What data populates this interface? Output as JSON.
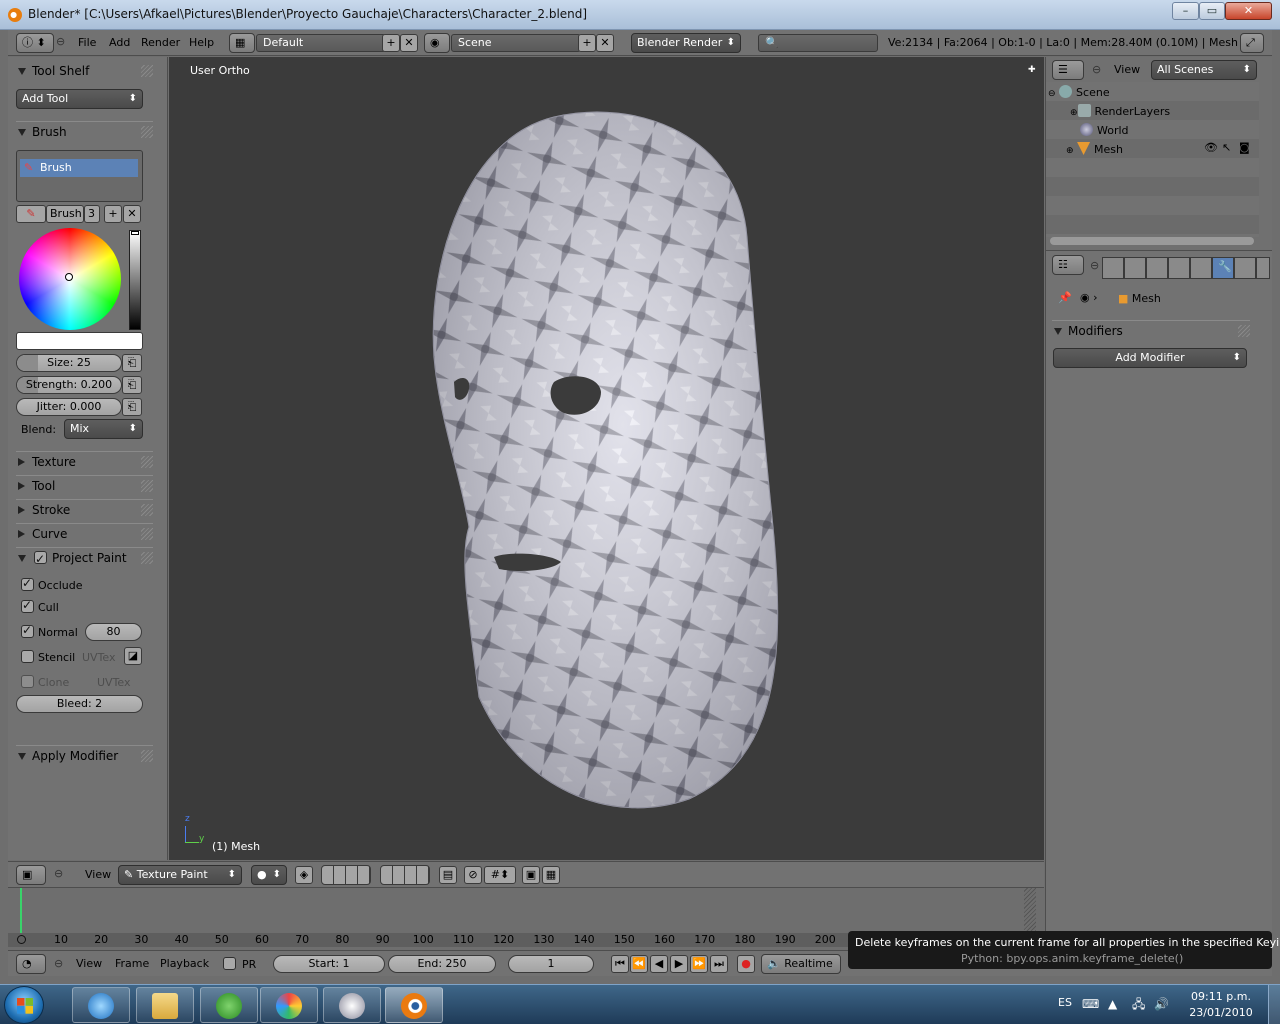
{
  "window": {
    "title": "Blender* [C:\\Users\\Afkael\\Pictures\\Blender\\Proyecto Gauchaje\\Characters\\Character_2.blend]",
    "minimize": "–",
    "maximize": "▭",
    "close": "✕"
  },
  "topheader": {
    "menus": [
      "File",
      "Add",
      "Render",
      "Help"
    ],
    "layout": "Default",
    "scene": "Scene",
    "engine": "Blender Render",
    "stats": "Ve:2134 | Fa:2064 | Ob:1-0 | La:0 | Mem:28.40M (0.10M) | Mesh"
  },
  "toolshelf": {
    "title": "Tool Shelf",
    "add_tool": "Add Tool",
    "brush_panel": "Brush",
    "brush_item": "Brush",
    "brush_name": "Brush",
    "brush_users": "3",
    "size": "Size: 25",
    "size_fill": 0.2,
    "strength": "Strength: 0.200",
    "strength_fill": 0.2,
    "jitter": "Jitter: 0.000",
    "jitter_fill": 0.0,
    "blend_label": "Blend:",
    "blend_value": "Mix",
    "texture": "Texture",
    "tool": "Tool",
    "stroke": "Stroke",
    "curve": "Curve",
    "project_paint": "Project Paint",
    "occlude": "Occlude",
    "cull": "Cull",
    "normal": "Normal",
    "normal_value": "80",
    "stencil": "Stencil",
    "stencil_uv": "UVTex",
    "clone": "Clone",
    "clone_uv": "UVTex",
    "bleed": "Bleed: 2",
    "apply_modifier": "Apply Modifier"
  },
  "viewport": {
    "view_label": "User Ortho",
    "object_label": "(1) Mesh",
    "axis_z": "z",
    "axis_y": "y"
  },
  "vpheader": {
    "view": "View",
    "mode": "Texture Paint"
  },
  "timeline": {
    "ticks": [
      "10",
      "20",
      "30",
      "40",
      "50",
      "60",
      "70",
      "80",
      "90",
      "100",
      "110",
      "120",
      "130",
      "140",
      "150",
      "160",
      "170",
      "180",
      "190",
      "200"
    ],
    "menus": [
      "View",
      "Frame",
      "Playback"
    ],
    "pr": "PR",
    "start": "Start: 1",
    "end": "End: 250",
    "current": "1",
    "sync": "Realtime"
  },
  "outliner": {
    "view": "View",
    "filter": "All Scenes",
    "items": [
      "Scene",
      "RenderLayers",
      "World",
      "Mesh"
    ]
  },
  "properties": {
    "breadcrumb": "Mesh",
    "modifiers": "Modifiers",
    "add_modifier": "Add Modifier"
  },
  "tooltip": {
    "text": "Delete keyframes on the current frame for all properties in the specified Keying Set.",
    "python": "Python: bpy.ops.anim.keyframe_delete()"
  },
  "taskbar": {
    "lang": "ES",
    "time": "09:11 p.m.",
    "date": "23/01/2010"
  },
  "colors": {
    "panel": "#727272",
    "viewport_bg": "#3b3b3b",
    "selection": "#5c82b6",
    "taskbar": "#2a4b6b"
  }
}
